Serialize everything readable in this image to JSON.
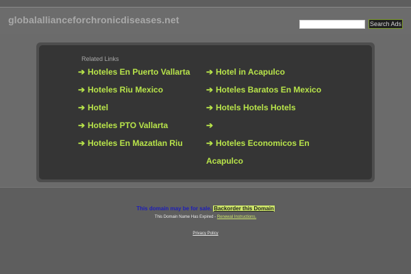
{
  "header": {
    "site_title": "globalallianceforchronicdiseases.net",
    "search_value": "",
    "search_button_label": "Search Ads"
  },
  "related": {
    "heading": "Related Links",
    "arrow_glyph": "➔",
    "left_links": [
      "Hoteles En Puerto Vallarta",
      "Hoteles Riu Mexico",
      "Hotel",
      "Hoteles PTO Vallarta",
      "Hoteles En Mazatlan Riu"
    ],
    "right_links": [
      "Hotel in Acapulco",
      "Hoteles Baratos En Mexico",
      "Hotels Hotels Hotels",
      "",
      "Hoteles Economicos En Acapulco"
    ],
    "link_color": "#b8e44a"
  },
  "footer": {
    "sale_text": "This domain may be for sale.",
    "backorder_label": "Backorder this Domain",
    "expired_text": "This Domain Name Has Expired -",
    "renewal_label": "Renewal Instructions.",
    "privacy_label": "Privacy Policy"
  }
}
